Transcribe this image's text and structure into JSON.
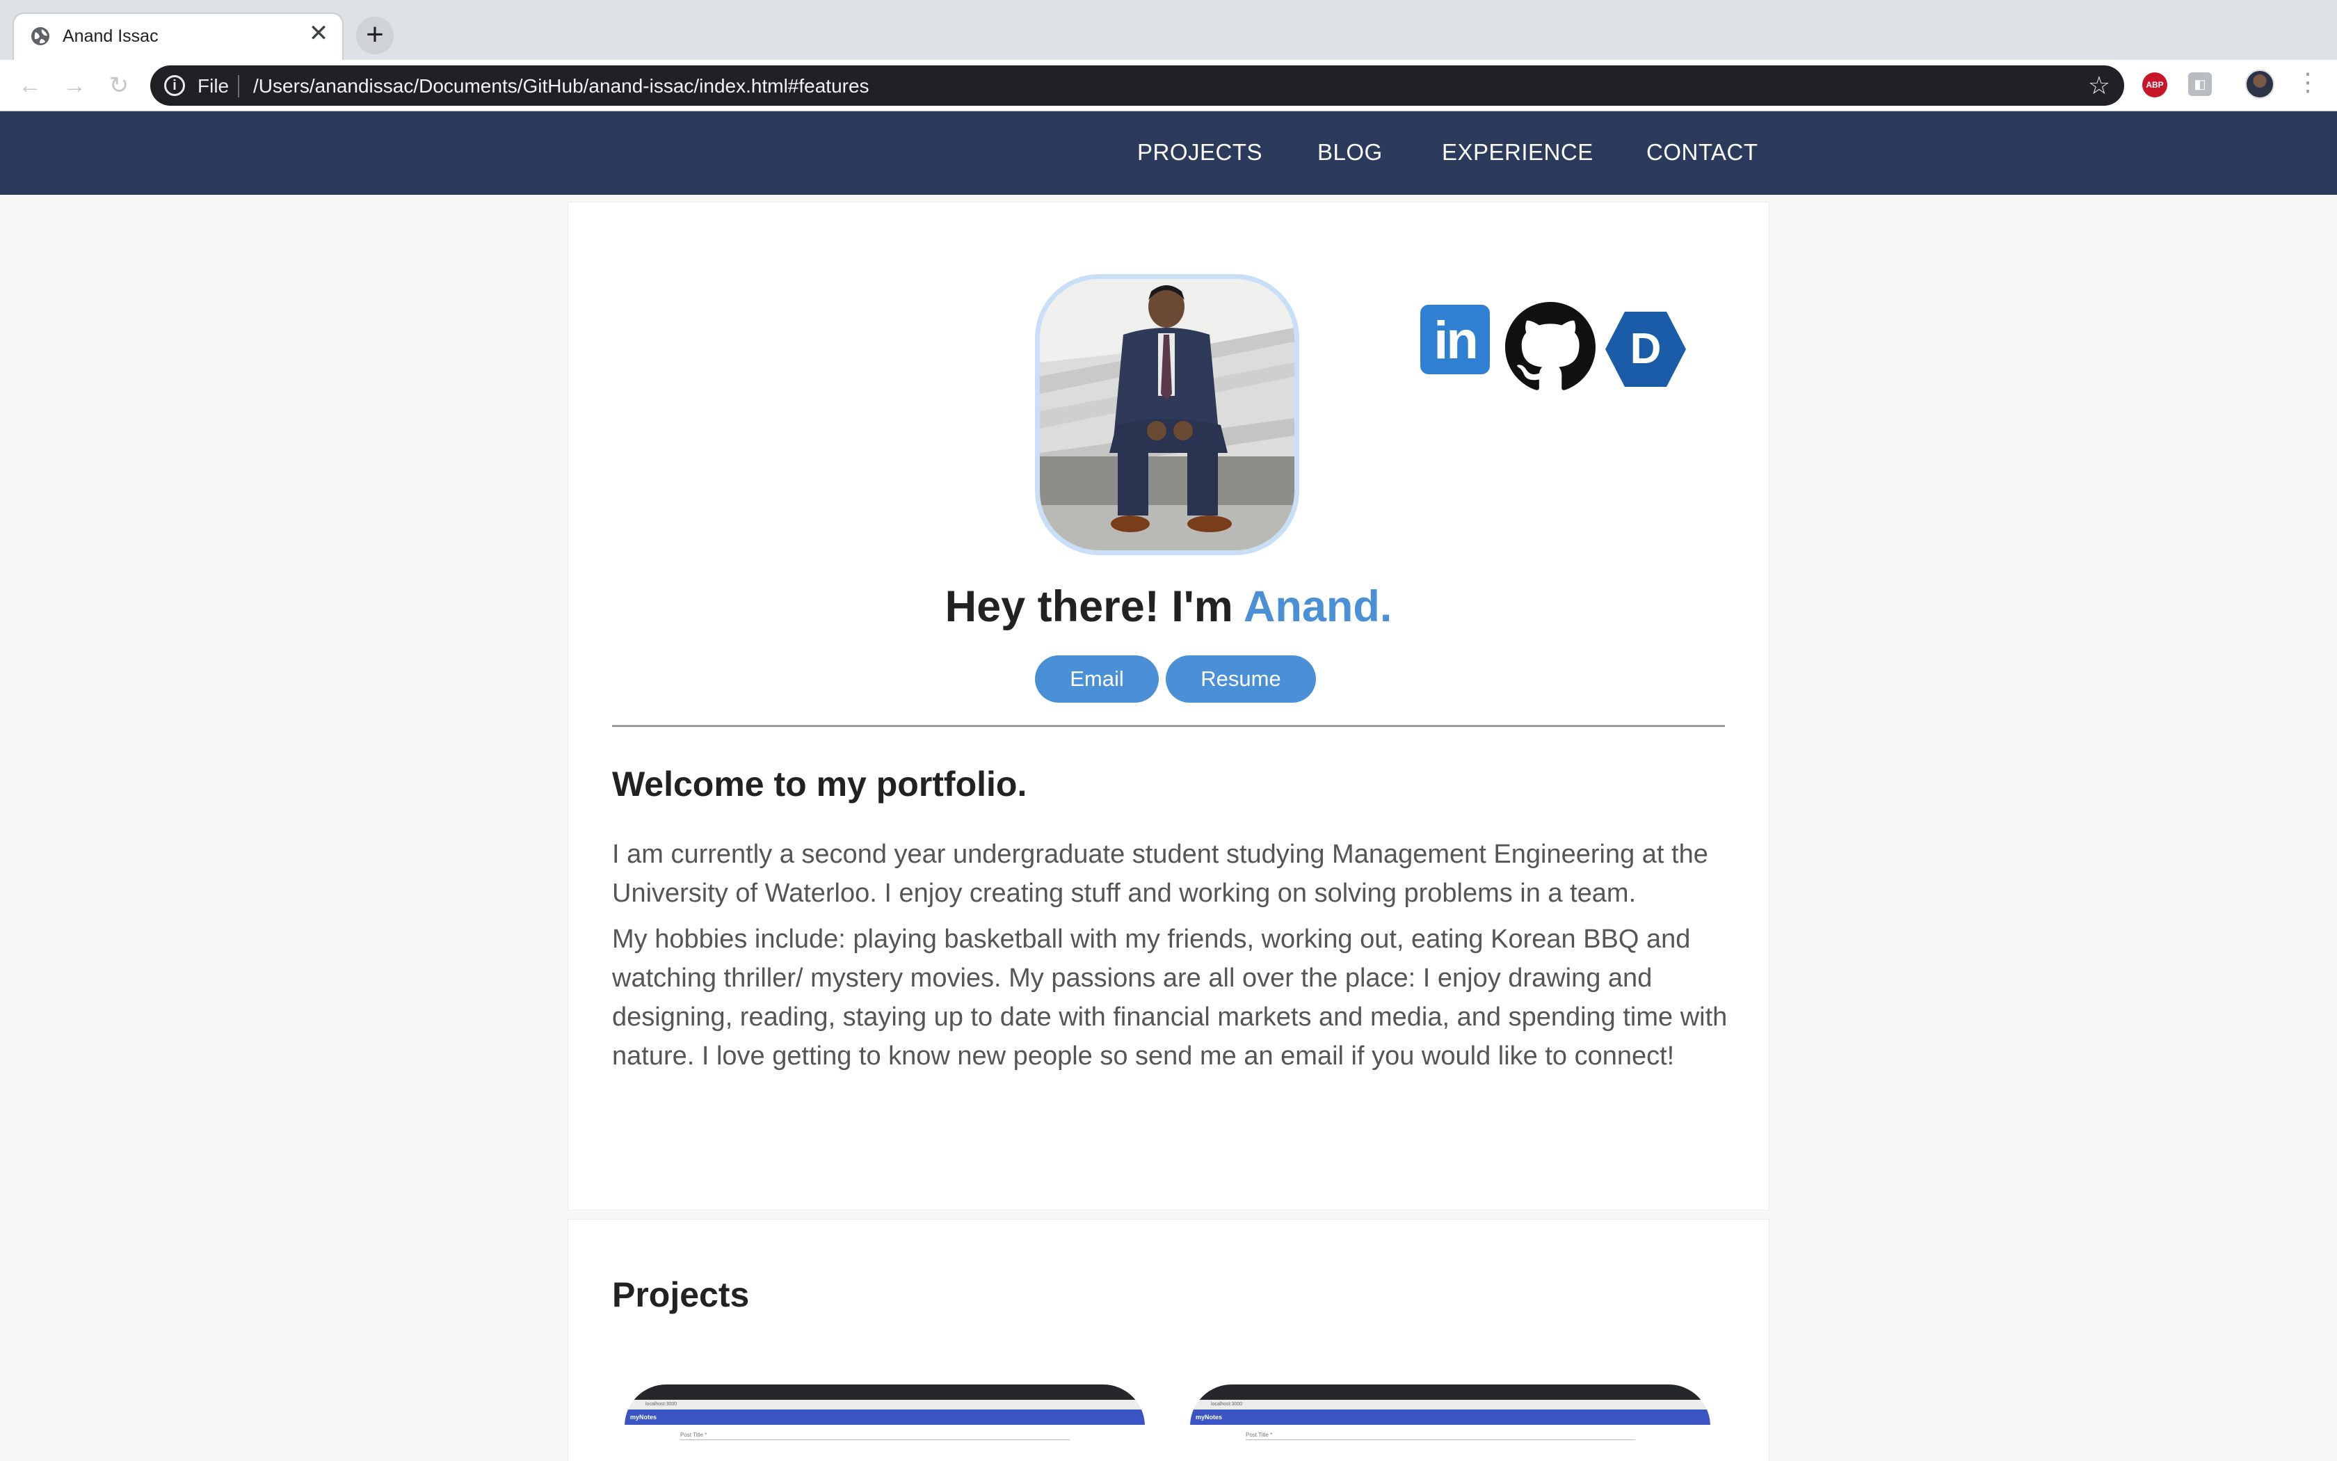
{
  "browser": {
    "tab_title": "Anand Issac",
    "close_glyph": "✕",
    "new_tab_glyph": "+",
    "file_label": "File",
    "url": "/Users/anandissac/Documents/GitHub/anand-issac/index.html#features",
    "extension_abp_label": "ABP",
    "icons": [
      "globe-icon",
      "close-icon",
      "plus-icon",
      "back-arrow-icon",
      "forward-arrow-icon",
      "reload-icon",
      "info-icon",
      "star-icon",
      "adblock-icon",
      "extension-icon",
      "profile-avatar",
      "kebab-menu-icon"
    ]
  },
  "nav": {
    "links": [
      "PROJECTS",
      "BLOG",
      "EXPERIENCE",
      "CONTACT"
    ],
    "background": "#2c3a5c"
  },
  "hero": {
    "greeting": "Hey there! I'm ",
    "name": "Anand.",
    "accent_color": "#4a90d6",
    "social_icons": [
      "linkedin-icon",
      "github-icon",
      "devpost-icon"
    ],
    "linkedin_text": "in",
    "dev_letter": "D",
    "buttons": {
      "email": "Email",
      "resume": "Resume"
    }
  },
  "about": {
    "heading": "Welcome to my portfolio.",
    "paragraph_1": "I am currently a second year undergraduate student studying Management Engineering at the University of Waterloo. I enjoy creating stuff and working on solving problems in a team.",
    "paragraph_2": "My hobbies include: playing basketball with my friends, working out, eating Korean BBQ and watching thriller/ mystery movies. My passions are all over the place: I enjoy drawing and designing, reading, staying up to date with financial markets and media, and spending time with nature. I love getting to know new people so send me an email if you would like to connect!"
  },
  "projects": {
    "heading": "Projects",
    "thumbnails": [
      {
        "app_name": "myNotes",
        "address": "localhost:3000",
        "field_label": "Post Title *"
      },
      {
        "app_name": "myNotes",
        "address": "localhost:3000",
        "field_label": "Post Title *"
      }
    ]
  }
}
